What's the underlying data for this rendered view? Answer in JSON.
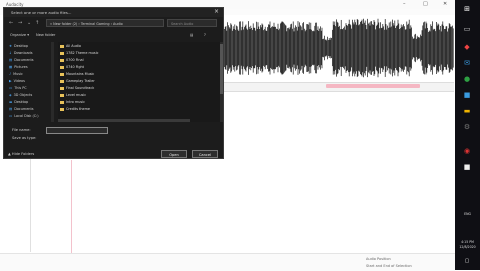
{
  "app": {
    "title": "Audacity",
    "status_left": "",
    "status_right": [
      "Audio Position",
      "Start and End of Selection"
    ]
  },
  "dialog": {
    "title": "Select one or more audio files...",
    "address": "« New folder (2) › Terminal Gaming › Audio",
    "search_placeholder": "Search Audio",
    "toolbar": {
      "organize": "Organize ▾",
      "new_folder": "New folder"
    },
    "nav_items": [
      "Desktop",
      "Downloads",
      "Documents",
      "Pictures",
      "Music",
      "Videos",
      "This PC",
      "3D Objects",
      "Desktop",
      "Documents",
      "Local Disk (C:)"
    ],
    "files": [
      "All Audio",
      "1782 Theme music",
      "0700 Final",
      "0740 Fight",
      "Mountains Music",
      "Gameplay Trailer",
      "Final Soundtrack",
      "Level music",
      "Intro music",
      "Credits theme"
    ],
    "filename_label": "File name:",
    "filename_value": "",
    "type_label": "Save as type:",
    "hide_folders": "▲ Hide Folders",
    "open_label": "Open",
    "cancel_label": "Cancel"
  },
  "taskbar": {
    "time": "4:15 PM",
    "date": "12/8/2020",
    "lang": "ENG"
  },
  "colors": {
    "selection": "#f5b7c3",
    "wave": "#111111",
    "accent": "#0078d7"
  }
}
